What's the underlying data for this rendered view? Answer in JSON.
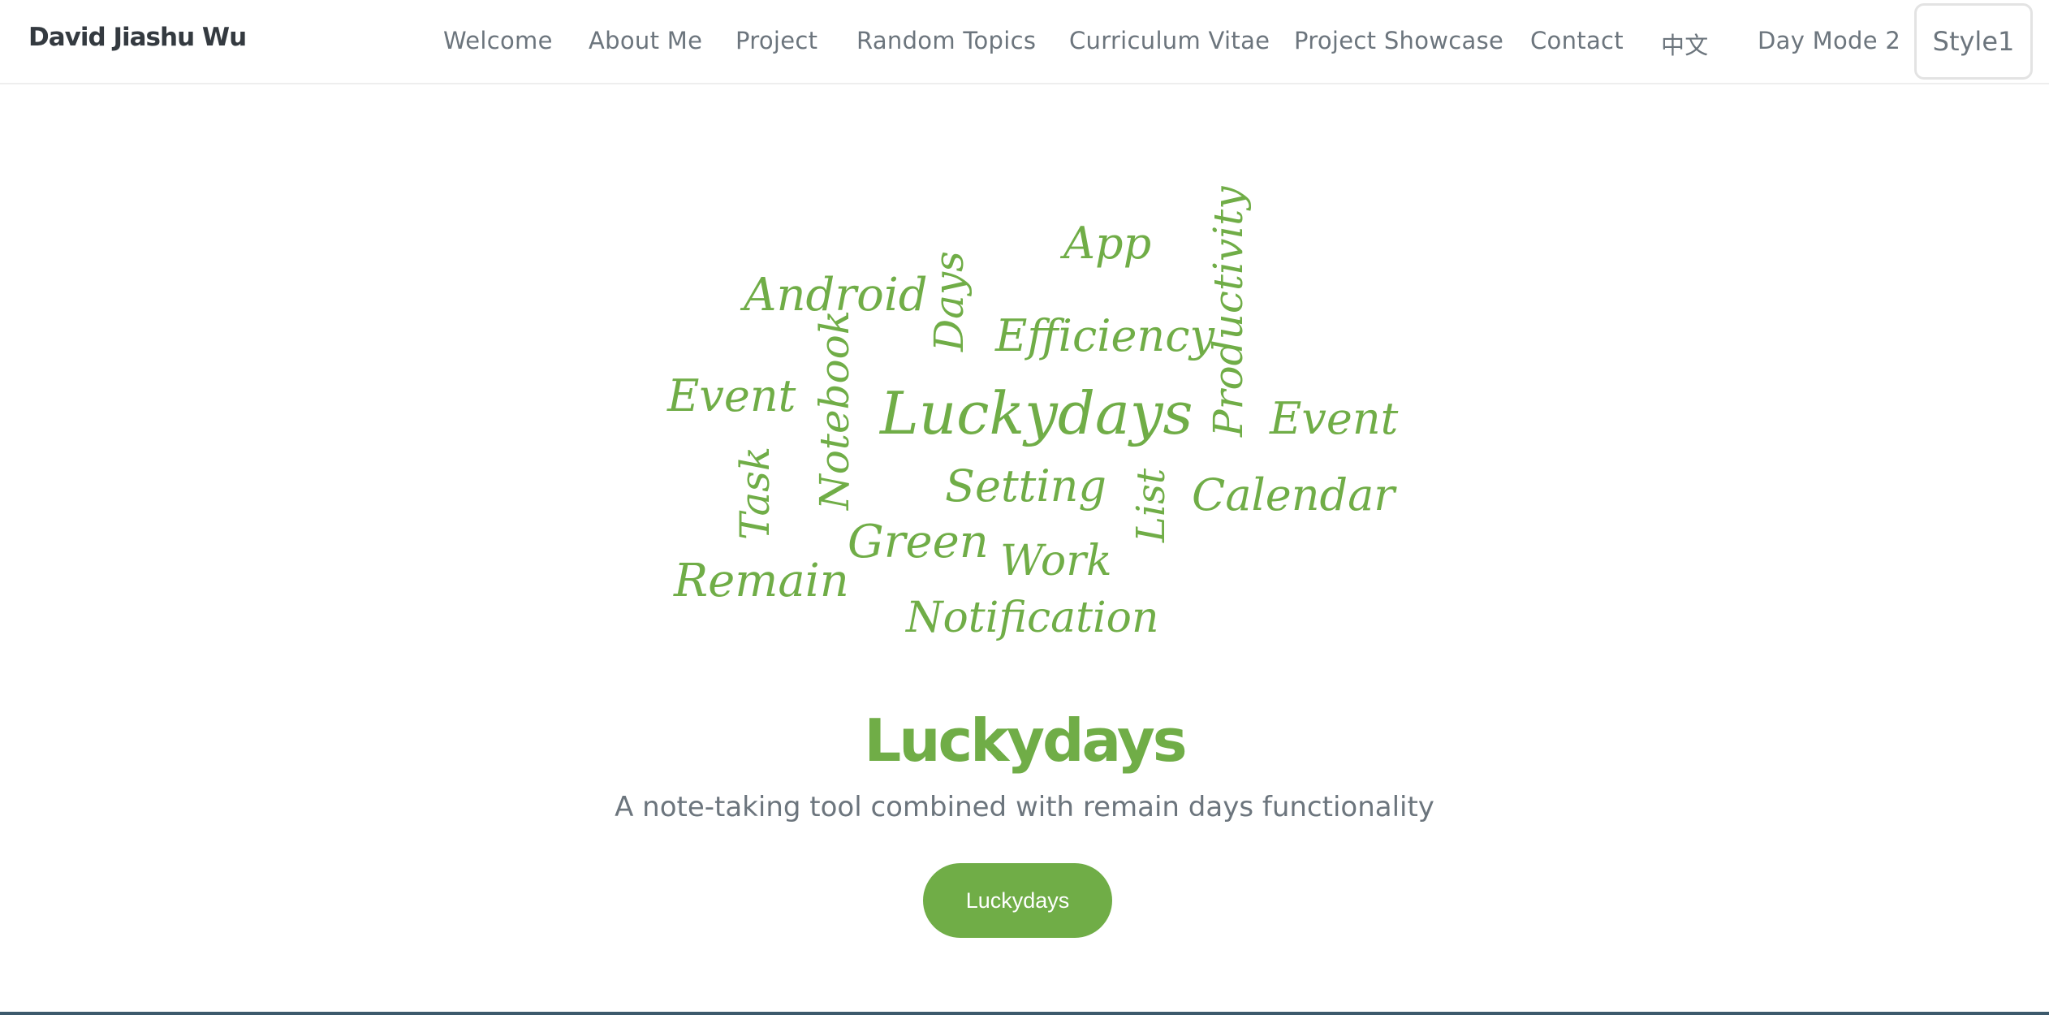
{
  "navbar": {
    "brand": "David Jiashu Wu",
    "items": [
      {
        "label": "Welcome"
      },
      {
        "label": "About Me"
      },
      {
        "label": "Project"
      },
      {
        "label": "Random Topics"
      },
      {
        "label": "Curriculum Vitae"
      },
      {
        "label": "Project Showcase"
      },
      {
        "label": "Contact"
      },
      {
        "label": "中文"
      },
      {
        "label": "Day Mode 2"
      }
    ],
    "style_button": "Style1"
  },
  "word_cloud": {
    "color": "#70ad47",
    "words": [
      "App",
      "Productivity",
      "Android",
      "Days",
      "Efficiency",
      "Event",
      "Notebook",
      "Luckydays",
      "Event",
      "Task",
      "Setting",
      "List",
      "Calendar",
      "Green",
      "Work",
      "Remain",
      "Notification"
    ]
  },
  "hero": {
    "title": "Luckydays",
    "subtitle": "A note-taking tool combined with remain days functionality",
    "button_label": "Luckydays"
  },
  "colors": {
    "accent": "#70ad47",
    "nav_text": "#6c757d",
    "brand_text": "#343a40",
    "footer_rule": "#3d5a6c"
  }
}
